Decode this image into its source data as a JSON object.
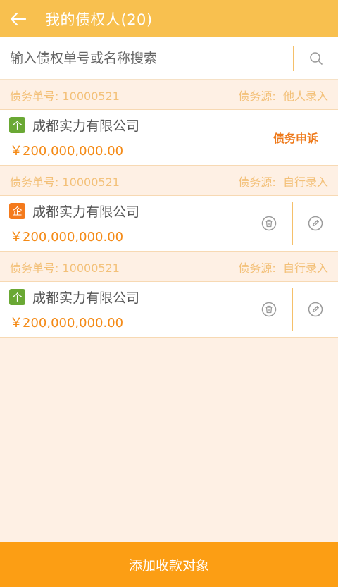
{
  "header": {
    "title": "我的债权人(20)"
  },
  "search": {
    "placeholder": "输入债权单号或名称搜索",
    "value": ""
  },
  "records": [
    {
      "order_label": "债务单号:",
      "order_no": "10000521",
      "source_label": "债务源:",
      "source": "他人录入",
      "badge": "个",
      "badge_type": "person",
      "company": "成都实力有限公司",
      "amount": "￥200,000,000.00",
      "action": "债务申诉"
    },
    {
      "order_label": "债务单号:",
      "order_no": "10000521",
      "source_label": "债务源:",
      "source": "自行录入",
      "badge": "企",
      "badge_type": "company",
      "company": "成都实力有限公司",
      "amount": "￥200,000,000.00"
    },
    {
      "order_label": "债务单号:",
      "order_no": "10000521",
      "source_label": "债务源:",
      "source": "自行录入",
      "badge": "个",
      "badge_type": "person",
      "company": "成都实力有限公司",
      "amount": "￥200,000,000.00"
    }
  ],
  "footer": {
    "button_label": "添加收款对象"
  },
  "icons": {
    "back": "arrow-left-icon",
    "search": "search-icon",
    "delete": "trash-icon",
    "edit": "pencil-icon"
  },
  "colors": {
    "primary": "#f8c04f",
    "accent": "#fc9e14",
    "amount": "#f48a16",
    "person_badge": "#6aa834",
    "company_badge": "#f47a1c",
    "background": "#fef0e4"
  }
}
